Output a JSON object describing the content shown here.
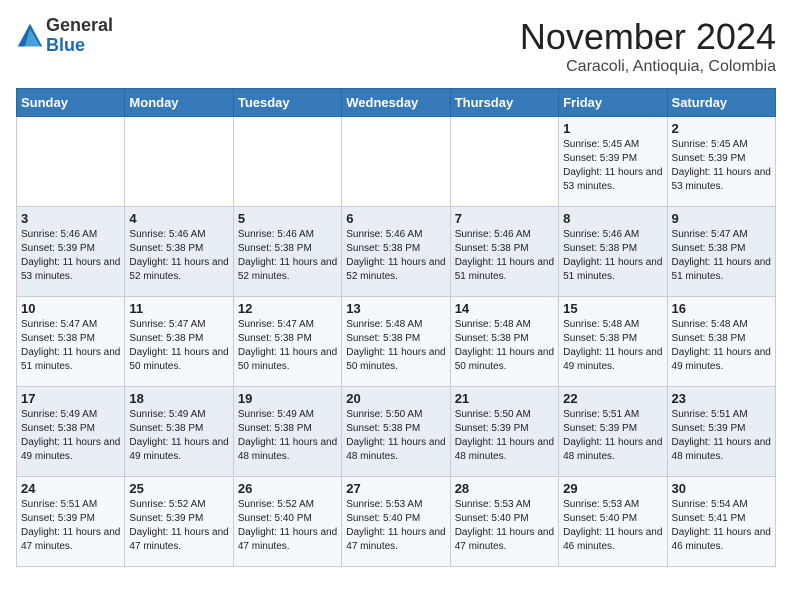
{
  "header": {
    "logo": {
      "general": "General",
      "blue": "Blue"
    },
    "title": "November 2024",
    "subtitle": "Caracoli, Antioquia, Colombia"
  },
  "calendar": {
    "weekdays": [
      "Sunday",
      "Monday",
      "Tuesday",
      "Wednesday",
      "Thursday",
      "Friday",
      "Saturday"
    ],
    "weeks": [
      [
        {
          "day": null
        },
        {
          "day": null
        },
        {
          "day": null
        },
        {
          "day": null
        },
        {
          "day": null
        },
        {
          "day": 1,
          "sunrise": "5:45 AM",
          "sunset": "5:39 PM",
          "daylight": "11 hours and 53 minutes."
        },
        {
          "day": 2,
          "sunrise": "5:45 AM",
          "sunset": "5:39 PM",
          "daylight": "11 hours and 53 minutes."
        }
      ],
      [
        {
          "day": 3,
          "sunrise": "5:46 AM",
          "sunset": "5:39 PM",
          "daylight": "11 hours and 53 minutes."
        },
        {
          "day": 4,
          "sunrise": "5:46 AM",
          "sunset": "5:38 PM",
          "daylight": "11 hours and 52 minutes."
        },
        {
          "day": 5,
          "sunrise": "5:46 AM",
          "sunset": "5:38 PM",
          "daylight": "11 hours and 52 minutes."
        },
        {
          "day": 6,
          "sunrise": "5:46 AM",
          "sunset": "5:38 PM",
          "daylight": "11 hours and 52 minutes."
        },
        {
          "day": 7,
          "sunrise": "5:46 AM",
          "sunset": "5:38 PM",
          "daylight": "11 hours and 51 minutes."
        },
        {
          "day": 8,
          "sunrise": "5:46 AM",
          "sunset": "5:38 PM",
          "daylight": "11 hours and 51 minutes."
        },
        {
          "day": 9,
          "sunrise": "5:47 AM",
          "sunset": "5:38 PM",
          "daylight": "11 hours and 51 minutes."
        }
      ],
      [
        {
          "day": 10,
          "sunrise": "5:47 AM",
          "sunset": "5:38 PM",
          "daylight": "11 hours and 51 minutes."
        },
        {
          "day": 11,
          "sunrise": "5:47 AM",
          "sunset": "5:38 PM",
          "daylight": "11 hours and 50 minutes."
        },
        {
          "day": 12,
          "sunrise": "5:47 AM",
          "sunset": "5:38 PM",
          "daylight": "11 hours and 50 minutes."
        },
        {
          "day": 13,
          "sunrise": "5:48 AM",
          "sunset": "5:38 PM",
          "daylight": "11 hours and 50 minutes."
        },
        {
          "day": 14,
          "sunrise": "5:48 AM",
          "sunset": "5:38 PM",
          "daylight": "11 hours and 50 minutes."
        },
        {
          "day": 15,
          "sunrise": "5:48 AM",
          "sunset": "5:38 PM",
          "daylight": "11 hours and 49 minutes."
        },
        {
          "day": 16,
          "sunrise": "5:48 AM",
          "sunset": "5:38 PM",
          "daylight": "11 hours and 49 minutes."
        }
      ],
      [
        {
          "day": 17,
          "sunrise": "5:49 AM",
          "sunset": "5:38 PM",
          "daylight": "11 hours and 49 minutes."
        },
        {
          "day": 18,
          "sunrise": "5:49 AM",
          "sunset": "5:38 PM",
          "daylight": "11 hours and 49 minutes."
        },
        {
          "day": 19,
          "sunrise": "5:49 AM",
          "sunset": "5:38 PM",
          "daylight": "11 hours and 48 minutes."
        },
        {
          "day": 20,
          "sunrise": "5:50 AM",
          "sunset": "5:38 PM",
          "daylight": "11 hours and 48 minutes."
        },
        {
          "day": 21,
          "sunrise": "5:50 AM",
          "sunset": "5:39 PM",
          "daylight": "11 hours and 48 minutes."
        },
        {
          "day": 22,
          "sunrise": "5:51 AM",
          "sunset": "5:39 PM",
          "daylight": "11 hours and 48 minutes."
        },
        {
          "day": 23,
          "sunrise": "5:51 AM",
          "sunset": "5:39 PM",
          "daylight": "11 hours and 48 minutes."
        }
      ],
      [
        {
          "day": 24,
          "sunrise": "5:51 AM",
          "sunset": "5:39 PM",
          "daylight": "11 hours and 47 minutes."
        },
        {
          "day": 25,
          "sunrise": "5:52 AM",
          "sunset": "5:39 PM",
          "daylight": "11 hours and 47 minutes."
        },
        {
          "day": 26,
          "sunrise": "5:52 AM",
          "sunset": "5:40 PM",
          "daylight": "11 hours and 47 minutes."
        },
        {
          "day": 27,
          "sunrise": "5:53 AM",
          "sunset": "5:40 PM",
          "daylight": "11 hours and 47 minutes."
        },
        {
          "day": 28,
          "sunrise": "5:53 AM",
          "sunset": "5:40 PM",
          "daylight": "11 hours and 47 minutes."
        },
        {
          "day": 29,
          "sunrise": "5:53 AM",
          "sunset": "5:40 PM",
          "daylight": "11 hours and 46 minutes."
        },
        {
          "day": 30,
          "sunrise": "5:54 AM",
          "sunset": "5:41 PM",
          "daylight": "11 hours and 46 minutes."
        }
      ]
    ]
  }
}
